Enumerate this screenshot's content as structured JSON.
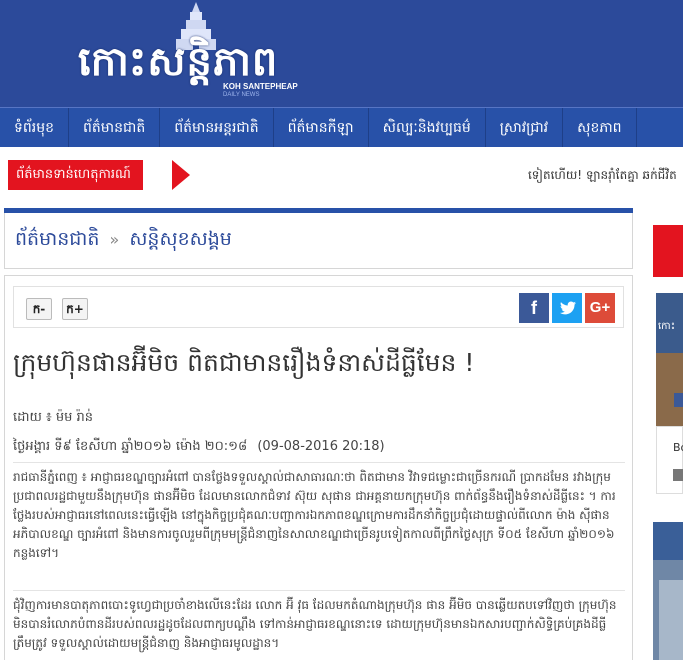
{
  "header": {
    "logo_text": "កោះសន្តិភាព",
    "logo_sub": "KOH SANTEPHEAP",
    "logo_sub2": "DAILY NEWS"
  },
  "nav": {
    "items": [
      "ទំព័រមុខ",
      "ព័ត៌មានជាតិ",
      "ព័ត៌មានអន្តរជាតិ",
      "ព័ត៌មានកីឡា",
      "សិល្បៈនិងវប្បធម៌",
      "ស្រាវជ្រាវ",
      "សុខភាព"
    ]
  },
  "breaking": {
    "label": "ព័ត៌មានទាន់ហេតុការណ៍",
    "ticker": "ទៀតហើយ! ឡានរ៉ាំតែគ្នា ឆក់ជីវិត"
  },
  "breadcrumb": {
    "section": "ព័ត៌មានជាតិ",
    "separator": "»",
    "subsection": "សន្តិសុខសង្គម"
  },
  "tools": {
    "font_smaller": "ក-",
    "font_larger": "ក+",
    "share_facebook": "f",
    "share_twitter": "t",
    "share_google": "G+"
  },
  "article": {
    "headline": "ក្រុមហ៊ុនផានអ៊ីមិច ពិតជាមានរឿងទំនាស់ដីធ្លីមែន !",
    "byline": "ដោយ ៖ ម៉ម រ៉ាន់",
    "date_khmer": "ថ្ងៃអង្គារ ទី៩ ខែសីហា ឆ្នាំ២០១៦ ម៉ោង ២០:១៨",
    "date_numeric": "(09-08-2016 20:18)",
    "paragraph1": "រាជធានីភ្នំពេញ ៖ អាជ្ញាធរខណ្ឌច្បារអំពៅ បានថ្លែងទទួលស្គាល់ជាសាធារណៈថា ពិតជាមាន វិវាទជម្លោះជាច្រើនករណី ប្រាកដមែន រវាងក្រុមប្រជាពលរដ្ឋជាមួយនឹងក្រុមហ៊ុន ផានអ៊ីមិច ដែលមានលោកជំទាវ ស៊ុយ សុផាន ជាអគ្គនាយកក្រុមហ៊ុន ពាក់ព័ន្ធនឹងរឿងទំនាស់ដីធ្លីនេះ ។ ការថ្លែងរបស់អាជ្ញាធរនៅពេលនេះធ្វើឡើង នៅក្នុងកិច្ចប្រជុំគណៈបញ្ជាការឯកភាពខណ្ឌក្រោមការដឹកនាំកិច្ចប្រជុំដោយផ្ទាល់ពីលោក ម៉ាង ស៊ីផាន អភិបាលខណ្ឌ ច្បារអំពៅ និងមានការចូលរួមពីក្រុមមន្ត្រីជំនាញនៃសាលាខណ្ឌជាច្រើនរូបទៀតកាលពីព្រឹកថ្ងៃសុក្រ ទី០៥ ខែសីហា ឆ្នាំ២០១៦ កន្លងទៅ។",
    "paragraph2": "ជុំវិញការមានបាតុភាពបោះទូហ្វេជាប្រចាំខាងលើនេះដែរ លោក អ៊ី វុធ ដែលមកតំណាងក្រុមហ៊ុន ផាន អ៊ីមិច បានឆ្លើយតបទៅវិញថា ក្រុមហ៊ុនមិនបានរំលោភបំពានដីរបស់ពលរដ្ឋដូចដែលពាក្យបណ្តឹង ទៅកាន់អាជ្ញាធរខណ្ឌនោះទេ ដោយក្រុមហ៊ុនមានឯកសារបញ្ជាក់សិទ្ធិគ្រប់គ្រងដីធ្លីត្រឹមត្រូវ ទទួលស្គាល់ដោយមន្ត្រីជំនាញ និងអាជ្ញាធរមូលដ្ឋាន។"
  },
  "sidebar": {
    "ad1_label": "កោះ",
    "box_text": "Bo"
  },
  "colors": {
    "header_bg": "#2c4a9a",
    "nav_bg": "#2851a8",
    "breaking_red": "#e3141f",
    "facebook": "#3b5998",
    "twitter": "#1da1f2",
    "google": "#dd4b39"
  }
}
